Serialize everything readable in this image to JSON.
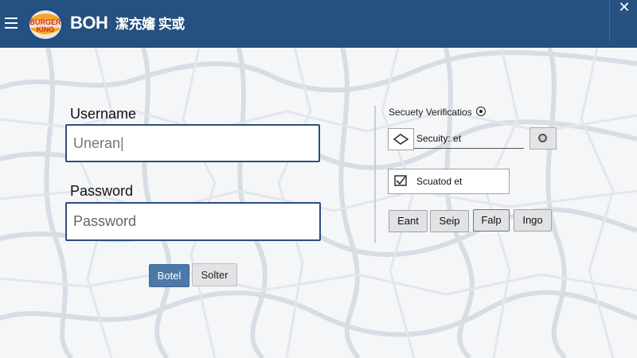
{
  "header": {
    "brand_top": "BURGER",
    "brand_bottom": "KING",
    "title": "BOH",
    "subtitle": "潔充嬸 实或",
    "close": "✕"
  },
  "login": {
    "username_label": "Username",
    "username_value": "Uneran|",
    "password_label": "Password",
    "password_placeholder": "Password",
    "submit_label": "Botel",
    "secondary_label": "Solter"
  },
  "security": {
    "title": "Secuety Verificatios",
    "row1_text": "Secuity: et",
    "row2_text": "Scuatod et",
    "buttons": [
      "Eant",
      "Seip",
      "Falp",
      "Ingo"
    ]
  },
  "colors": {
    "header_bg": "#25507f",
    "primary_button": "#4d79a7",
    "field_border": "#2c4f7a"
  }
}
